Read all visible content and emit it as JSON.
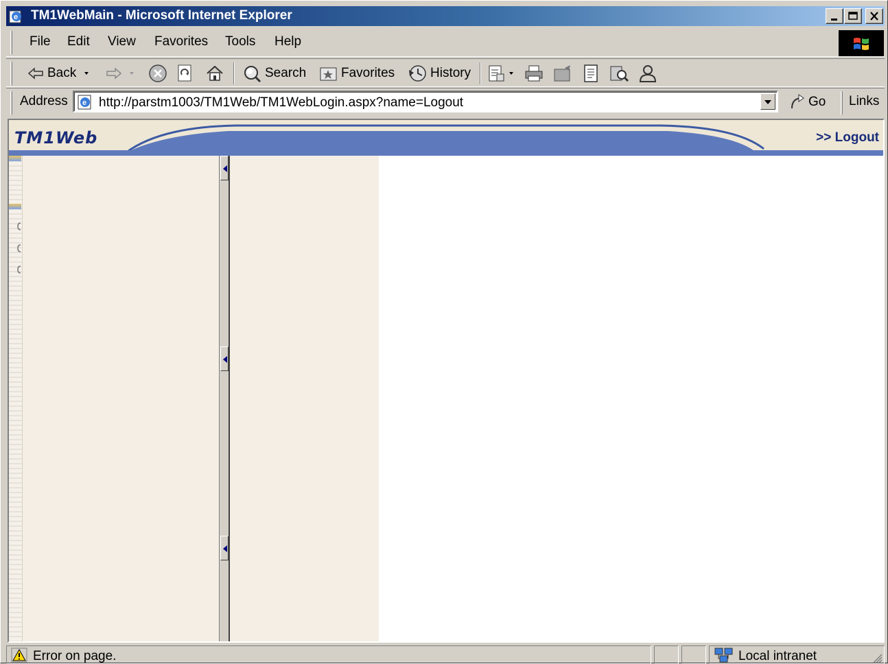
{
  "window": {
    "title": "TM1WebMain - Microsoft Internet Explorer"
  },
  "menubar": {
    "items": [
      "File",
      "Edit",
      "View",
      "Favorites",
      "Tools",
      "Help"
    ]
  },
  "toolbar": {
    "back_label": "Back",
    "search_label": "Search",
    "favorites_label": "Favorites",
    "history_label": "History"
  },
  "addressbar": {
    "label": "Address",
    "url": "http://parstm1003/TM1Web/TM1WebLogin.aspx?name=Logout",
    "go_label": "Go",
    "links_label": "Links"
  },
  "page": {
    "logo": "TM1Web",
    "logout_link": ">> Logout",
    "colors": {
      "accent": "#5e7abd",
      "header_bg": "#eee7d6",
      "panel_bg": "#f4eee4",
      "logo_text": "#1a2d7a"
    }
  },
  "statusbar": {
    "message": "Error on page.",
    "zone": "Local intranet"
  }
}
